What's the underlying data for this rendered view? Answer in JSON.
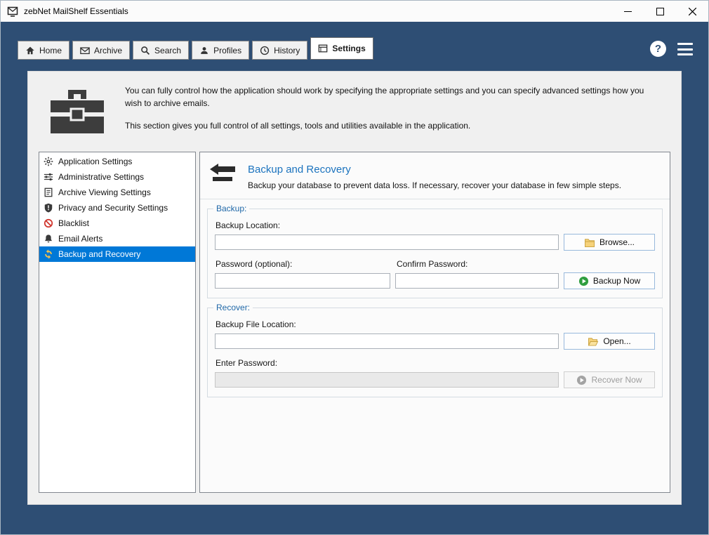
{
  "window": {
    "title": "zebNet MailShelf Essentials"
  },
  "tabs": [
    {
      "label": "Home",
      "icon": "home-icon",
      "active": false
    },
    {
      "label": "Archive",
      "icon": "archive-icon",
      "active": false
    },
    {
      "label": "Search",
      "icon": "search-icon",
      "active": false
    },
    {
      "label": "Profiles",
      "icon": "profiles-icon",
      "active": false
    },
    {
      "label": "History",
      "icon": "history-icon",
      "active": false
    },
    {
      "label": "Settings",
      "icon": "settings-icon",
      "active": true
    }
  ],
  "icons": {
    "help_glyph": "?"
  },
  "intro": {
    "paragraph1": "You can fully control how the application should work by specifying the appropriate settings and you can specify advanced settings how you wish to archive emails.",
    "paragraph2": "This section gives you full control of all settings, tools and utilities available in the application."
  },
  "sidebar": {
    "items": [
      {
        "label": "Application Settings",
        "icon": "gear-icon",
        "selected": false
      },
      {
        "label": "Administrative Settings",
        "icon": "sliders-icon",
        "selected": false
      },
      {
        "label": "Archive Viewing Settings",
        "icon": "document-icon",
        "selected": false
      },
      {
        "label": "Privacy and Security Settings",
        "icon": "shield-icon",
        "selected": false
      },
      {
        "label": "Blacklist",
        "icon": "prohibition-icon",
        "selected": false
      },
      {
        "label": "Email Alerts",
        "icon": "bell-icon",
        "selected": false
      },
      {
        "label": "Backup and Recovery",
        "icon": "backup-arrows-icon",
        "selected": true
      }
    ]
  },
  "panel": {
    "title": "Backup and Recovery",
    "subtitle": "Backup your database to prevent data loss. If necessary, recover your database in few simple steps.",
    "backup": {
      "legend": "Backup:",
      "location_label": "Backup Location:",
      "location_value": "",
      "browse_label": "Browse...",
      "password_label": "Password (optional):",
      "password_value": "",
      "confirm_label": "Confirm Password:",
      "confirm_value": "",
      "backup_now_label": "Backup Now"
    },
    "recover": {
      "legend": "Recover:",
      "file_label": "Backup File Location:",
      "file_value": "",
      "open_label": "Open...",
      "password_label": "Enter Password:",
      "password_value": "",
      "recover_now_label": "Recover Now"
    }
  },
  "colors": {
    "navy": "#2e4e74",
    "selection_accent": "#0078d7",
    "panel_title_blue": "#1b73be",
    "legend_blue": "#2068a8",
    "blacklist_red": "#d0342c",
    "backup_icon_yellow": "#f2c14e",
    "backup_now_green": "#2f9e3f"
  }
}
